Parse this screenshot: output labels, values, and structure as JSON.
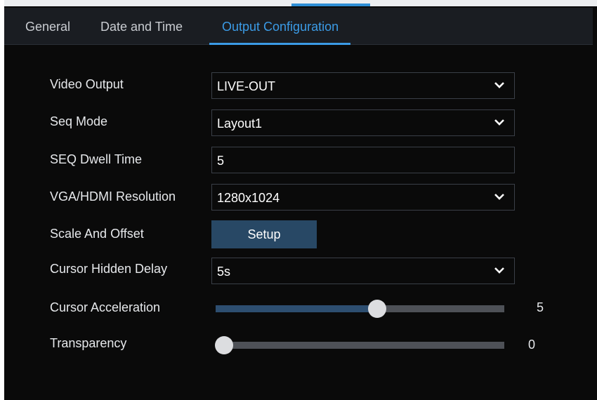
{
  "tabs": [
    {
      "label": "General",
      "active": false
    },
    {
      "label": "Date and Time",
      "active": false
    },
    {
      "label": "Output Configuration",
      "active": true
    }
  ],
  "settings": {
    "video_output": {
      "label": "Video Output",
      "value": "LIVE-OUT",
      "icon": "chevron-down-icon"
    },
    "seq_mode": {
      "label": "Seq Mode",
      "value": "Layout1",
      "icon": "chevron-down-icon"
    },
    "seq_dwell_time": {
      "label": "SEQ Dwell Time",
      "value": "5"
    },
    "resolution": {
      "label": "VGA/HDMI Resolution",
      "value": "1280x1024",
      "icon": "chevron-down-icon"
    },
    "scale_offset": {
      "label": "Scale And Offset",
      "button_label": "Setup"
    },
    "cursor_hidden_delay": {
      "label": "Cursor Hidden Delay",
      "value": "5s",
      "icon": "chevron-down-icon"
    },
    "cursor_acceleration": {
      "label": "Cursor Acceleration",
      "value": "5",
      "level_fraction": 0.56
    },
    "transparency": {
      "label": "Transparency",
      "value": "0",
      "level_fraction": 0.03
    }
  },
  "colors": {
    "accent": "#3b9be6",
    "background": "#0a0a0a",
    "tab_bar": "#1a1d22",
    "button": "#284865",
    "slider_fill": "#2d4e70"
  }
}
